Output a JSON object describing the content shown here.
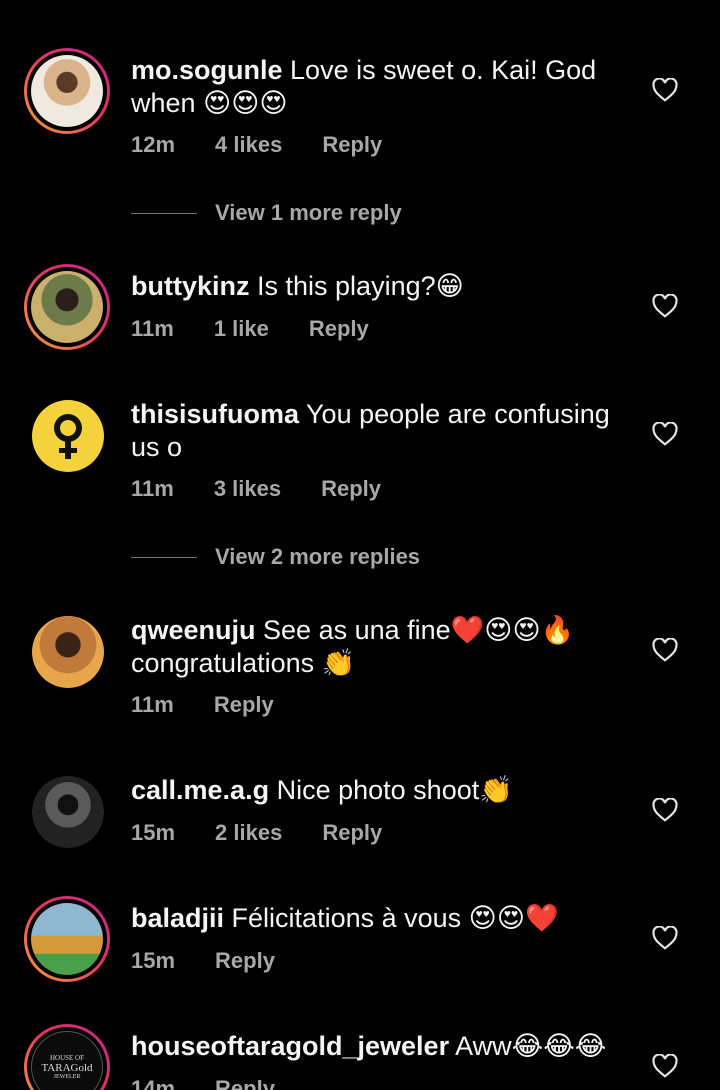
{
  "comments": [
    {
      "username": "mo.sogunle",
      "text": "Love is sweet o. Kai! God when",
      "emoji": "😍😍😍",
      "time": "12m",
      "likes": "4 likes",
      "reply": "Reply"
    },
    {
      "username": "buttykinz",
      "text": "Is this playing?",
      "emoji": "😁",
      "time": "11m",
      "likes": "1 like",
      "reply": "Reply"
    },
    {
      "username": "thisisufuoma",
      "text": "You people are confusing us o",
      "emoji": "",
      "time": "11m",
      "likes": "3 likes",
      "reply": "Reply"
    },
    {
      "username": "qweenuju",
      "text": "See as una fine",
      "emoji": "❤️😍😍🔥",
      "text2": "congratulations",
      "emoji2": "👏",
      "time": "11m",
      "likes": "",
      "reply": "Reply"
    },
    {
      "username": "call.me.a.g",
      "text": "Nice photo shoot",
      "emoji": "👏",
      "time": "15m",
      "likes": "2 likes",
      "reply": "Reply"
    },
    {
      "username": "baladjii",
      "text": "Félicitations à vous",
      "emoji": "😍😍❤️",
      "time": "15m",
      "likes": "",
      "reply": "Reply"
    },
    {
      "username": "houseoftaragold_jeweler",
      "text": "Aww",
      "emoji": "😂😂😂",
      "time": "14m",
      "likes": "",
      "reply": "Reply"
    }
  ],
  "view_more": [
    "View 1 more reply",
    "View 2 more replies"
  ],
  "logo_text": {
    "line1": "HOUSE OF",
    "line2": "TARAGold",
    "line3": "JEWELER"
  }
}
